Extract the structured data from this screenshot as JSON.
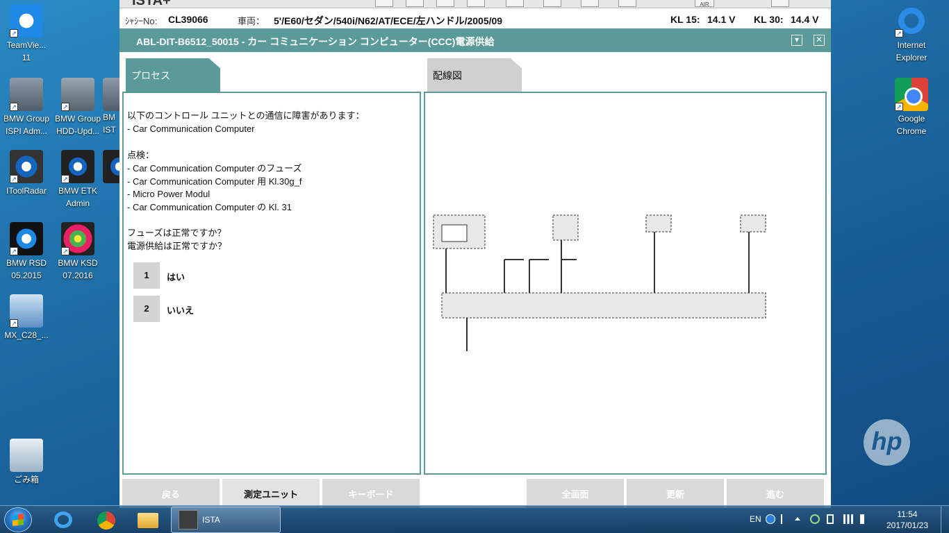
{
  "desktop": {
    "icons": [
      {
        "label": "TeamVie...\n11",
        "l1": "TeamVie...",
        "l2": "11"
      },
      {
        "l1": "BMW Group",
        "l2": "ISPI Adm..."
      },
      {
        "l1": "BMW Group",
        "l2": "HDD-Upd..."
      },
      {
        "l1": "BM",
        "l2": "IST"
      },
      {
        "l1": "IToolRadar",
        "l2": ""
      },
      {
        "l1": "BMW ETK",
        "l2": "Admin"
      },
      {
        "l1": "BMW RSD",
        "l2": "05.2015"
      },
      {
        "l1": "BMW KSD",
        "l2": "07.2016"
      },
      {
        "l1": "MX_C28_...",
        "l2": ""
      },
      {
        "l1": "ごみ箱",
        "l2": ""
      },
      {
        "l1": "Internet",
        "l2": "Explorer"
      },
      {
        "l1": "Google",
        "l2": "Chrome"
      }
    ],
    "ksd_badge": "KSD",
    "ispi_badge": "ISPI",
    "hdd_badge": "HDD",
    "hp_logo": "hp"
  },
  "ista": {
    "app_title": "ISTA+",
    "vin_label": "ｼｬｼｰNo:",
    "vin": "CL39066",
    "vehicle_label": "車両：",
    "vehicle": "5'/E60/セダン/540i/N62/AT/ECE/左ハンドル/2005/09",
    "kl15_label": "KL 15:",
    "kl15": "14.1 V",
    "kl30_label": "KL 30:",
    "kl30": "14.4 V",
    "toolbar_air": "AIR",
    "window_title": "ABL-DIT-B6512_50015 - カー コミュニケーション コンピューター(CCC)電源供給",
    "tab_process": "プロセス",
    "tab_wiring": "配線図",
    "process": {
      "line1": "以下のコントロール ユニットとの通信に障害があります：",
      "line2": "- Car Communication Computer",
      "check_heading": "点検：",
      "checks": [
        "- Car Communication Computer のフューズ",
        "- Car Communication Computer 用 Kl.30g_f",
        "- Micro Power Modul",
        "- Car Communication Computer の Kl. 31"
      ],
      "question1": "フューズは正常ですか？",
      "question2": "電源供給は正常ですか？",
      "answers": [
        {
          "num": "1",
          "label": "はい"
        },
        {
          "num": "2",
          "label": "いいえ"
        }
      ]
    },
    "buttons": {
      "back": "戻る",
      "measure": "測定ユニット",
      "keyboard": "キーボード",
      "fullscreen": "全画面",
      "refresh": "更新",
      "next": "進む"
    }
  },
  "taskbar": {
    "ista_label": "ISTA",
    "lang": "EN",
    "time": "11:54",
    "date": "2017/01/23"
  }
}
